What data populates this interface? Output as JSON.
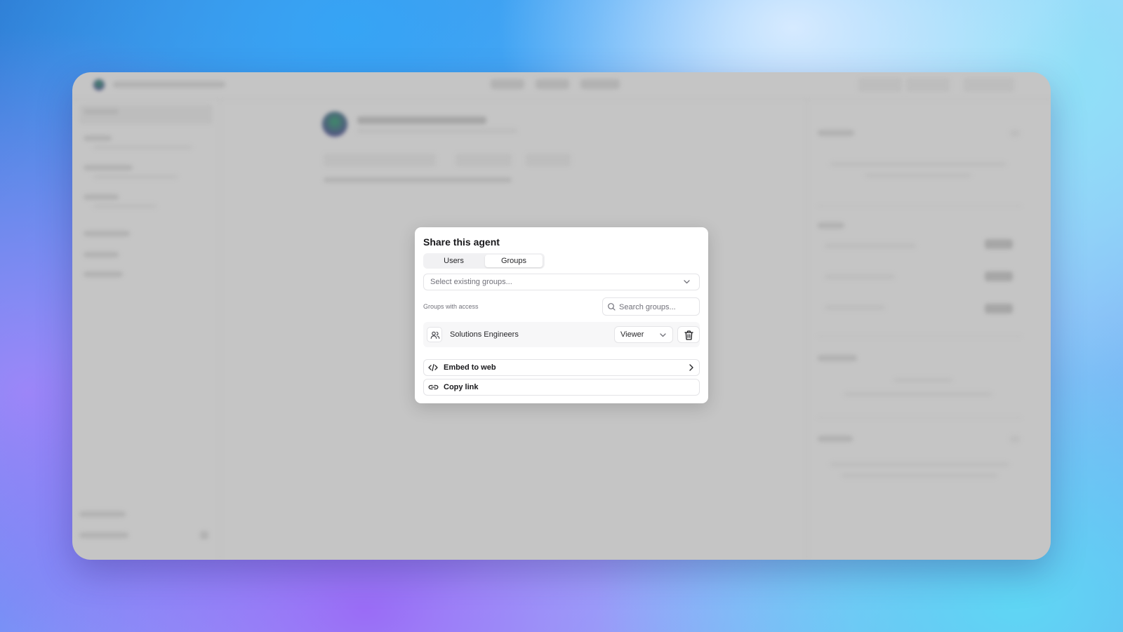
{
  "modal": {
    "title": "Share this agent",
    "tabs": [
      {
        "label": "Users",
        "active": false
      },
      {
        "label": "Groups",
        "active": true
      }
    ],
    "select_groups": {
      "placeholder": "Select existing groups..."
    },
    "groups_section_label": "Groups with access",
    "search_groups": {
      "placeholder": "Search groups..."
    },
    "groups": [
      {
        "name": "Solutions Engineers",
        "role": "Viewer",
        "icon": "users-icon"
      }
    ],
    "actions": [
      {
        "label": "Embed to web",
        "icon": "code-icon",
        "trailing_icon": "chevron-right-icon"
      },
      {
        "label": "Copy link",
        "icon": "link-icon"
      }
    ]
  },
  "colors": {
    "modal_background": "#ffffff",
    "overlay": "#c5c5c5",
    "text_primary": "#18181b",
    "text_muted": "#71717a",
    "border": "#e4e4e7"
  }
}
